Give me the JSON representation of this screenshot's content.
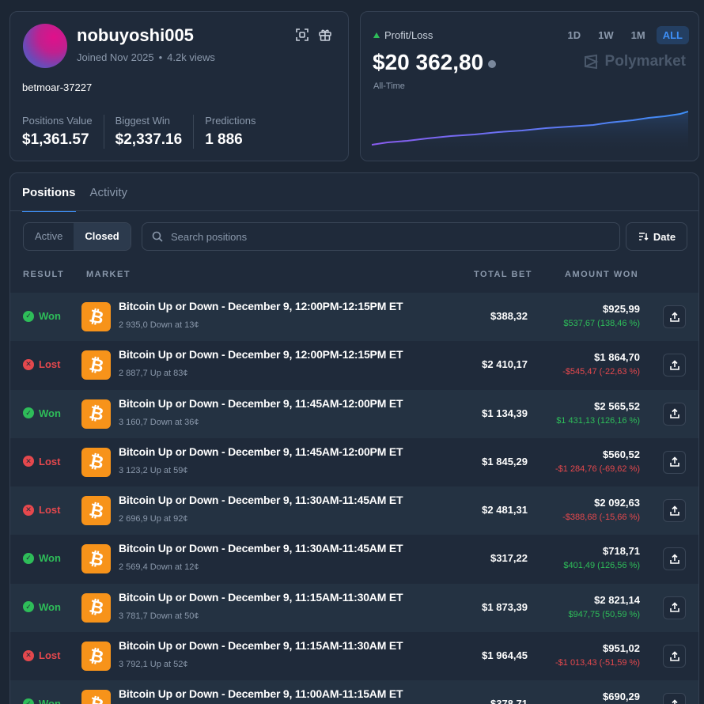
{
  "profile": {
    "username": "nobuyoshi005",
    "joined": "Joined Nov 2025",
    "views": "4.2k views",
    "handle": "betmoar-37227",
    "stats": [
      {
        "label": "Positions Value",
        "value": "$1,361.57"
      },
      {
        "label": "Biggest Win",
        "value": "$2,337.16"
      },
      {
        "label": "Predictions",
        "value": "1 886"
      }
    ]
  },
  "pnl": {
    "label": "Profit/Loss",
    "value": "$20 362,80",
    "period": "All-Time",
    "ranges": [
      "1D",
      "1W",
      "1M",
      "ALL"
    ],
    "active_range": "ALL",
    "brand": "Polymarket"
  },
  "tabs": [
    "Positions",
    "Activity"
  ],
  "filters": {
    "segments": [
      "Active",
      "Closed"
    ],
    "active_segment": "Closed",
    "search_placeholder": "Search positions",
    "sort_label": "Date"
  },
  "columns": {
    "result": "RESULT",
    "market": "MARKET",
    "total_bet": "TOTAL BET",
    "amount_won": "AMOUNT WON"
  },
  "positions": [
    {
      "result": "Won",
      "title": "Bitcoin Up or Down - December 9, 12:00PM-12:15PM ET",
      "detail": "2 935,0 Down at 13¢",
      "bet": "$388,32",
      "won": "$925,99",
      "delta": "$537,67 (138,46 %)"
    },
    {
      "result": "Lost",
      "title": "Bitcoin Up or Down - December 9, 12:00PM-12:15PM ET",
      "detail": "2 887,7 Up at 83¢",
      "bet": "$2 410,17",
      "won": "$1 864,70",
      "delta": "-$545,47 (-22,63 %)"
    },
    {
      "result": "Won",
      "title": "Bitcoin Up or Down - December 9, 11:45AM-12:00PM ET",
      "detail": "3 160,7 Down at 36¢",
      "bet": "$1 134,39",
      "won": "$2 565,52",
      "delta": "$1 431,13 (126,16 %)"
    },
    {
      "result": "Lost",
      "title": "Bitcoin Up or Down - December 9, 11:45AM-12:00PM ET",
      "detail": "3 123,2 Up at 59¢",
      "bet": "$1 845,29",
      "won": "$560,52",
      "delta": "-$1 284,76 (-69,62 %)"
    },
    {
      "result": "Lost",
      "title": "Bitcoin Up or Down - December 9, 11:30AM-11:45AM ET",
      "detail": "2 696,9 Up at 92¢",
      "bet": "$2 481,31",
      "won": "$2 092,63",
      "delta": "-$388,68 (-15,66 %)"
    },
    {
      "result": "Won",
      "title": "Bitcoin Up or Down - December 9, 11:30AM-11:45AM ET",
      "detail": "2 569,4 Down at 12¢",
      "bet": "$317,22",
      "won": "$718,71",
      "delta": "$401,49 (126,56 %)"
    },
    {
      "result": "Won",
      "title": "Bitcoin Up or Down - December 9, 11:15AM-11:30AM ET",
      "detail": "3 781,7 Down at 50¢",
      "bet": "$1 873,39",
      "won": "$2 821,14",
      "delta": "$947,75 (50,59 %)"
    },
    {
      "result": "Lost",
      "title": "Bitcoin Up or Down - December 9, 11:15AM-11:30AM ET",
      "detail": "3 792,1 Up at 52¢",
      "bet": "$1 964,45",
      "won": "$951,02",
      "delta": "-$1 013,43 (-51,59 %)"
    },
    {
      "result": "Won",
      "title": "Bitcoin Up or Down - December 9, 11:00AM-11:15AM ET",
      "detail": "",
      "bet": "$378,71",
      "won": "$690,29",
      "delta": ""
    }
  ]
}
